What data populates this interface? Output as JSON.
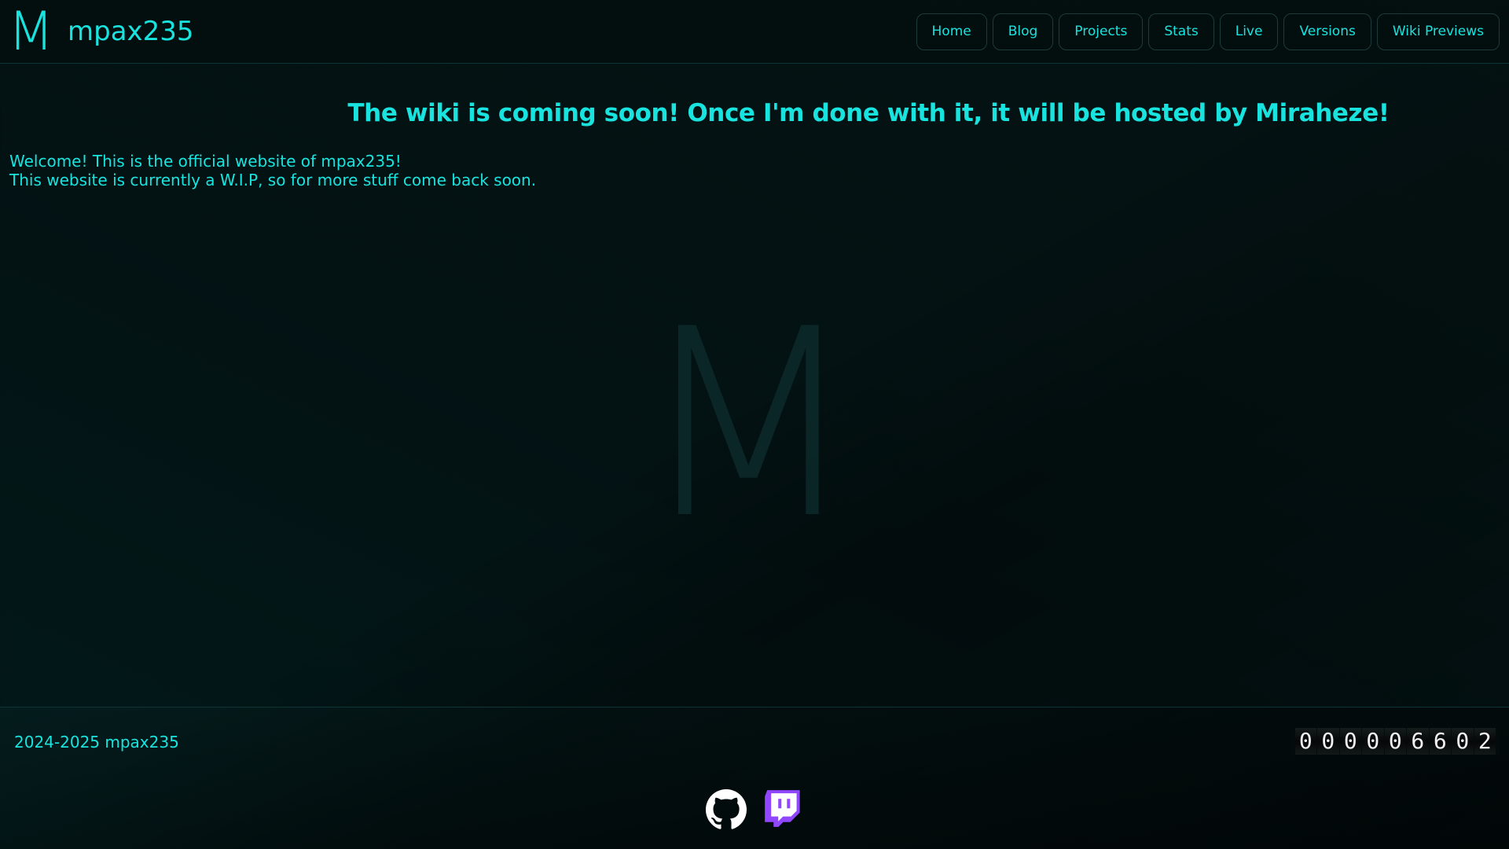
{
  "header": {
    "logo_letter": "M",
    "site_name": "mpax235",
    "nav": [
      {
        "label": "Home"
      },
      {
        "label": "Blog"
      },
      {
        "label": "Projects"
      },
      {
        "label": "Stats"
      },
      {
        "label": "Live"
      },
      {
        "label": "Versions"
      },
      {
        "label": "Wiki Previews"
      }
    ]
  },
  "main": {
    "banner": "The wiki is coming soon! Once I'm done with it, it will be hosted by Miraheze!",
    "intro_line1": "Welcome! This is the official website of mpax235!",
    "intro_line2": "This website is currently a W.I.P, so for more stuff come back soon.",
    "watermark": "M"
  },
  "footer": {
    "copyright": "2024-2025 mpax235",
    "visit_counter": [
      "0",
      "0",
      "0",
      "0",
      "0",
      "6",
      "6",
      "0",
      "2"
    ],
    "social": [
      {
        "icon": "github-icon",
        "color": "#ffffff"
      },
      {
        "icon": "twitch-icon",
        "color": "#9146ff"
      }
    ]
  },
  "colors": {
    "accent": "#19e3de",
    "background": "#031314",
    "twitch": "#9146ff"
  }
}
